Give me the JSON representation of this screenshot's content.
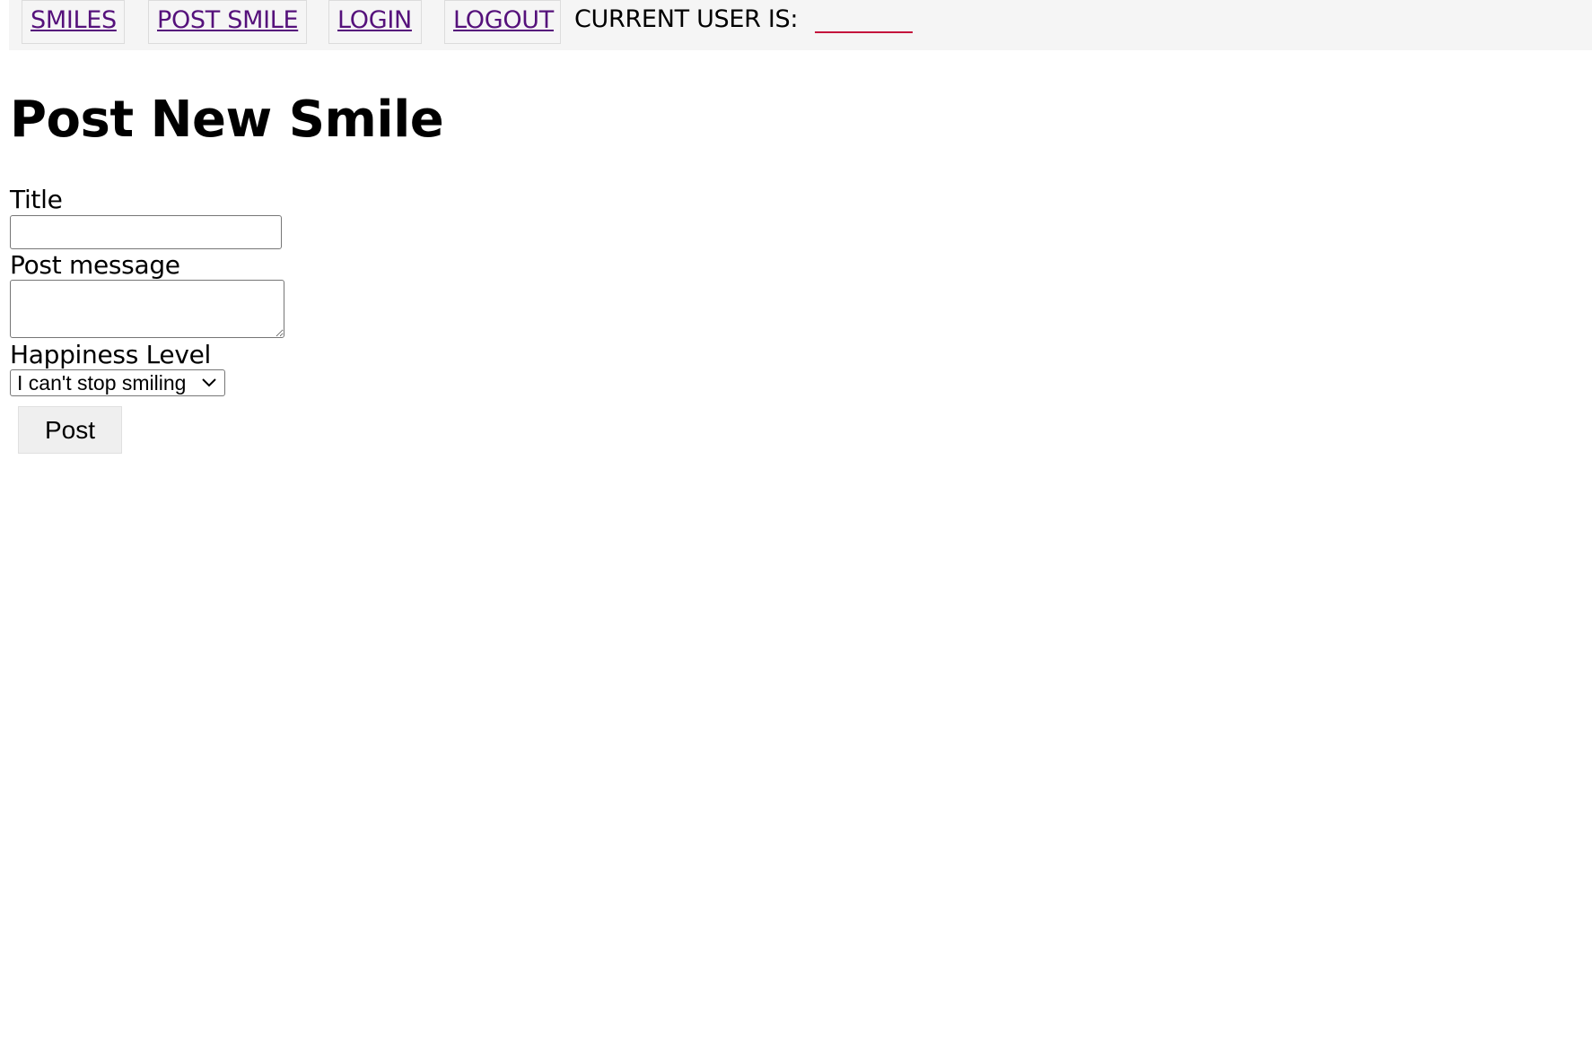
{
  "nav": {
    "items": [
      {
        "label": "SMILES"
      },
      {
        "label": "POST SMILE"
      },
      {
        "label": "LOGIN"
      },
      {
        "label": "LOGOUT"
      }
    ],
    "current_user_label": "CURRENT USER IS:",
    "current_user_value": ""
  },
  "page": {
    "title": "Post New Smile"
  },
  "form": {
    "title_label": "Title",
    "title_value": "",
    "message_label": "Post message",
    "message_value": "",
    "happiness_label": "Happiness Level",
    "happiness_selected": "I can't stop smiling",
    "submit_label": "Post"
  },
  "colors": {
    "link": "#55117b",
    "navbar_bg": "#f5f5f5",
    "current_user_underline": "#c4123c",
    "button_bg": "#efefef"
  },
  "icons": {
    "select_arrow": "chevron-down-icon"
  }
}
